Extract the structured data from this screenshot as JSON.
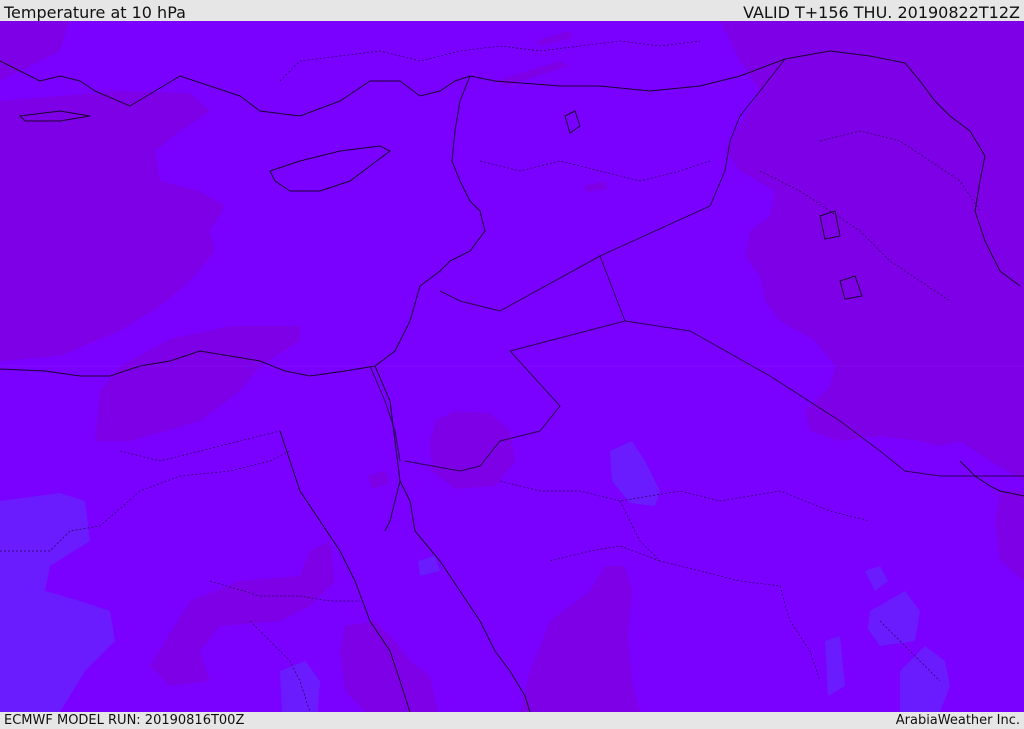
{
  "header": {
    "title": "Temperature at 10 hPa",
    "valid_time": "VALID T+156 THU. 20190822T12Z"
  },
  "footer": {
    "model_run": "ECMWF MODEL RUN: 20190816T00Z",
    "credit": "ArabiaWeather Inc."
  },
  "colors": {
    "base_field": "#7a00ff",
    "warm_field": "#7e00e6",
    "cool_field": "#6a1cff",
    "coastline": "#1a0033",
    "border": "#2a0055"
  }
}
